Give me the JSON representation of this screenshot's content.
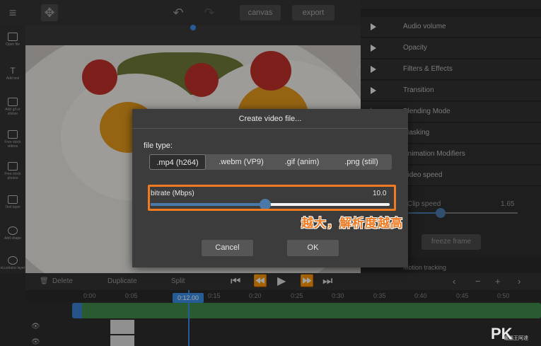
{
  "topbar": {
    "canvas_label": "canvas",
    "export_label": "export"
  },
  "left_tools": [
    {
      "label": "Open file"
    },
    {
      "label": "Add text"
    },
    {
      "label": "Add gif or sticker"
    },
    {
      "label": "Free stock videos"
    },
    {
      "label": "Free stock photos"
    },
    {
      "label": "Text layer"
    },
    {
      "label": "Add shape"
    },
    {
      "label": "eLustrator layer"
    }
  ],
  "right_panel": {
    "items": [
      {
        "label": "Audio volume"
      },
      {
        "label": "Opacity"
      },
      {
        "label": "Filters & Effects"
      },
      {
        "label": "Transition"
      },
      {
        "label": "Blending Mode"
      },
      {
        "label": "Masking"
      },
      {
        "label": "Animation Modifiers"
      },
      {
        "label": "Video speed"
      }
    ],
    "speed_label": "Clip speed",
    "speed_value": "1.65",
    "freeze_label": "freeze frame",
    "motion_label": "Motion tracking"
  },
  "dialog": {
    "title": "Create video file...",
    "file_type_label": "file type:",
    "file_types": [
      ".mp4 (h264)",
      ".webm (VP9)",
      ".gif (anim)",
      ".png (still)"
    ],
    "selected_type": ".mp4 (h264)",
    "bitrate_label": "bitrate (Mbps)",
    "bitrate_value": "10.0",
    "bitrate_fraction": 0.48,
    "cancel_label": "Cancel",
    "ok_label": "OK"
  },
  "annotation": "越大，解析度越高",
  "timeline": {
    "delete_label": "Delete",
    "duplicate_label": "Duplicate",
    "split_label": "Split",
    "playhead_label": "0:12.00",
    "ticks": [
      "0:00",
      "0:05",
      "0:15",
      "0:20",
      "0:25",
      "0:30",
      "0:35",
      "0:40",
      "0:45",
      "0:50"
    ]
  },
  "watermark": {
    "text": "PK",
    "sub": "電腦王阿達"
  },
  "colors": {
    "accent_blue": "#4a78a8",
    "highlight_orange": "#f07a22",
    "track_green": "#3f8a4a"
  }
}
